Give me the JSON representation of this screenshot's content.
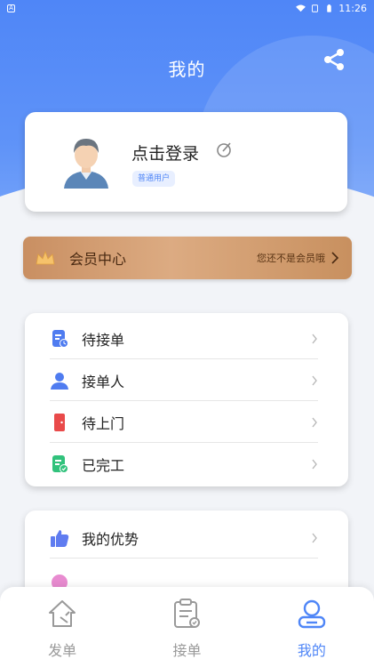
{
  "status_bar": {
    "time": "11:26",
    "app_badge": "A"
  },
  "header": {
    "title": "我的",
    "share_icon": "share-icon"
  },
  "profile": {
    "login_text": "点击登录",
    "user_type": "普通用户"
  },
  "member": {
    "label": "会员中心",
    "hint": "您还不是会员哦"
  },
  "menu_group_1": [
    {
      "label": "待接单",
      "icon": "pending-order-icon",
      "color": "#4f7cf0"
    },
    {
      "label": "接单人",
      "icon": "person-icon",
      "color": "#4f7cf0"
    },
    {
      "label": "待上门",
      "icon": "door-icon",
      "color": "#e94a4a"
    },
    {
      "label": "已完工",
      "icon": "completed-icon",
      "color": "#31c27c"
    }
  ],
  "menu_group_2": [
    {
      "label": "我的优势",
      "icon": "thumbs-up-icon",
      "color": "#5f7cf0"
    }
  ],
  "bottom_nav": [
    {
      "label": "发单",
      "icon": "home-icon",
      "active": false
    },
    {
      "label": "接单",
      "icon": "clipboard-icon",
      "active": false
    },
    {
      "label": "我的",
      "icon": "profile-icon",
      "active": true
    }
  ],
  "colors": {
    "primary": "#4f86f7",
    "gold": "#d4a176"
  }
}
